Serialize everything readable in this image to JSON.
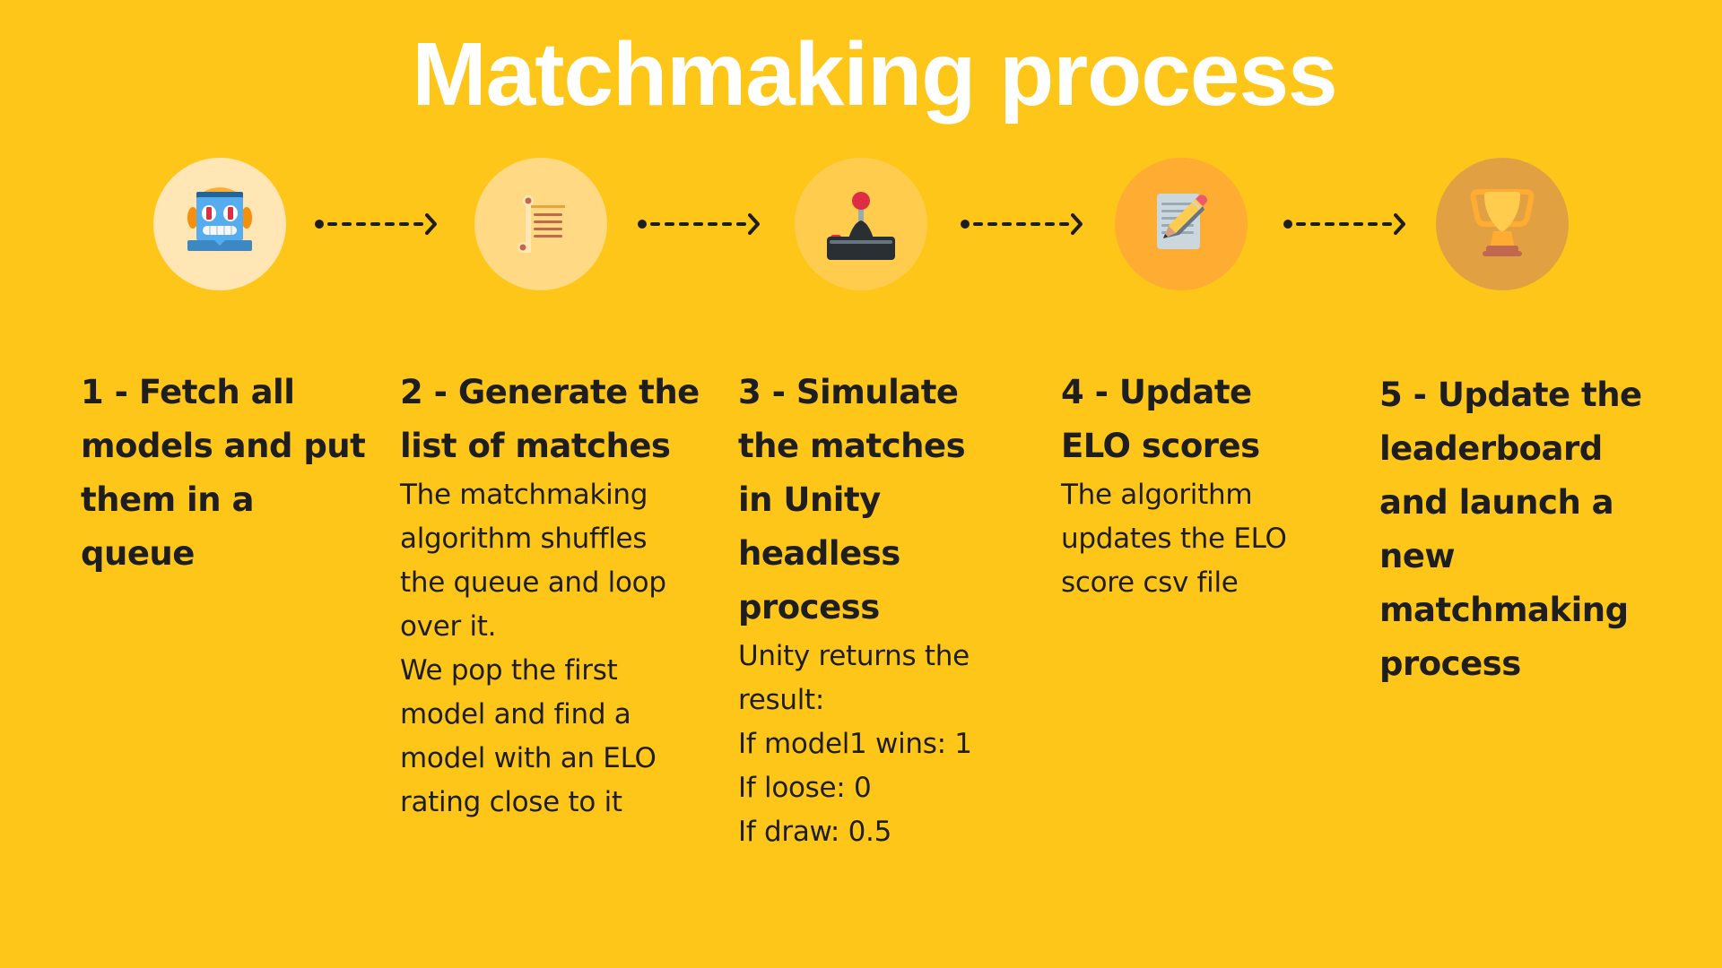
{
  "title": "Matchmaking process",
  "colors": {
    "background": "#FFC61A",
    "title": "#FFFFFF",
    "text": "#1E1E1E",
    "arrow": "#1E1E1E"
  },
  "steps": [
    {
      "icon": "robot-icon",
      "circle_color": "#FFE6B4",
      "heading_lines": [
        "1 - Fetch all",
        "models and put",
        "them in a",
        "queue"
      ],
      "body_lines": []
    },
    {
      "icon": "scroll-list-icon",
      "circle_color": "#FFD983",
      "heading_lines": [
        "2 - Generate the",
        "list of matches"
      ],
      "body_lines": [
        "The matchmaking",
        "algorithm shuffles",
        "the queue and loop",
        "over it.",
        "We pop the first",
        "model and find a",
        "model with an ELO",
        "rating close to it"
      ]
    },
    {
      "icon": "joystick-icon",
      "circle_color": "#FFCC4D",
      "heading_lines": [
        "3 - Simulate",
        "the matches",
        "in Unity",
        "headless",
        "process"
      ],
      "body_lines": [
        "Unity returns the",
        "result:",
        "If model1 wins: 1",
        "If loose: 0",
        "If draw: 0.5"
      ]
    },
    {
      "icon": "memo-pencil-icon",
      "circle_color": "#FFAC33",
      "heading_lines": [
        "4 - Update",
        "ELO scores"
      ],
      "body_lines": [
        "The algorithm",
        "updates the ELO",
        "score csv file"
      ]
    },
    {
      "icon": "trophy-icon",
      "circle_color": "#E1A142",
      "heading_lines": [
        "5 - Update the",
        "leaderboard",
        "and launch a",
        "new",
        "matchmaking",
        "process"
      ],
      "body_lines": []
    }
  ]
}
